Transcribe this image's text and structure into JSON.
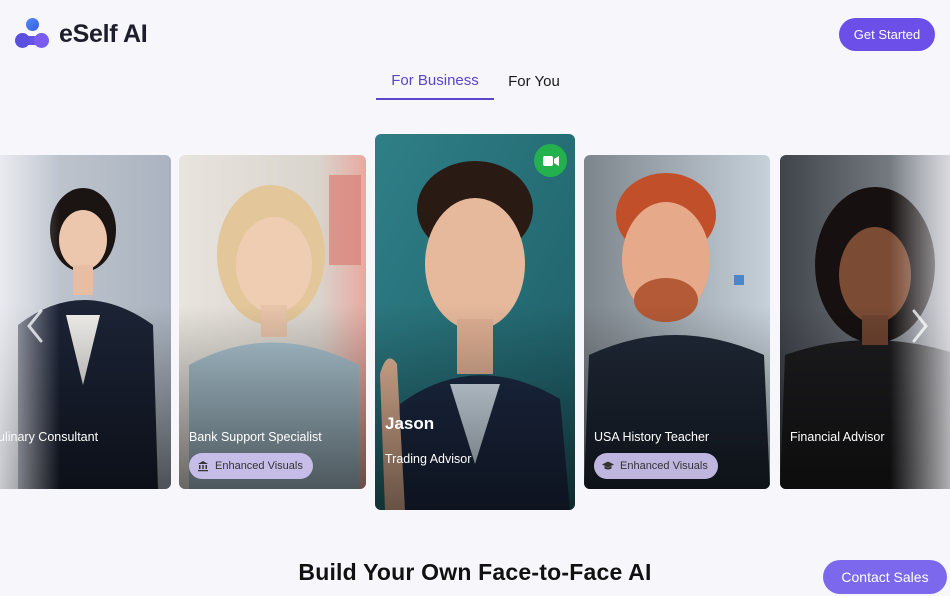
{
  "header": {
    "brand": "eSelf AI",
    "cta_label": "Get Started"
  },
  "tabs": [
    {
      "label": "For Business",
      "active": true
    },
    {
      "label": "For You",
      "active": false
    }
  ],
  "cards": [
    {
      "title": "Culinary Consultant",
      "visible_title": "ulinary Consultant",
      "badge": null
    },
    {
      "title": "Bank Support Specialist",
      "badge": "Enhanced Visuals",
      "badge_icon": "bank-icon"
    },
    {
      "name": "Jason",
      "title": "Trading Advisor",
      "featured": true,
      "action_icon": "video-camera-icon"
    },
    {
      "title": "USA History Teacher",
      "badge": "Enhanced Visuals",
      "badge_icon": "graduation-cap-icon"
    },
    {
      "title": "Financial Advisor",
      "badge": null
    }
  ],
  "carousel": {
    "prev_icon": "chevron-left-icon",
    "next_icon": "chevron-right-icon"
  },
  "hero": {
    "headline": "Build Your Own Face-to-Face AI"
  },
  "contact": {
    "label": "Contact Sales"
  },
  "colors": {
    "accent": "#6b4fe8",
    "accent_text": "#5a46c9",
    "video_green": "#22b14c",
    "badge_bg": "#d2c8f5"
  }
}
